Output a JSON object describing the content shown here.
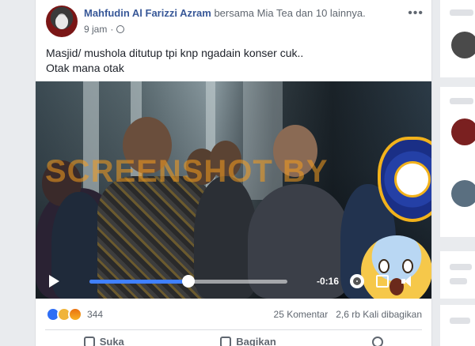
{
  "post": {
    "author": "Mahfudin Al Farizzi Azram",
    "with_text": "bersama Mia Tea dan 10 lainnya.",
    "time": "9 jam",
    "privacy_icon": "globe-icon",
    "more_icon": "more-options-icon",
    "text_lines": [
      "Masjid/ mushola ditutup tpi knp ngadain konser cuk..",
      "Otak mana otak"
    ]
  },
  "video": {
    "watermark": "SCREENSHOT BY",
    "seal_icon": "mafindo-turnbackhoax-seal-icon",
    "emoji_icon": "screaming-face-emoji",
    "time_remaining": "-0:16",
    "progress": 0.5,
    "progress_color": "#4080ff"
  },
  "engagement": {
    "reaction_icons": [
      "like-icon",
      "wow-icon",
      "angry-icon"
    ],
    "reaction_count": "344",
    "comments": "25 Komentar",
    "shares": "2,6 rb Kali dibagikan"
  },
  "actions": {
    "like": "Suka",
    "share": "Bagikan"
  },
  "colors": {
    "author_link": "#385898",
    "background": "#e9ebee"
  }
}
